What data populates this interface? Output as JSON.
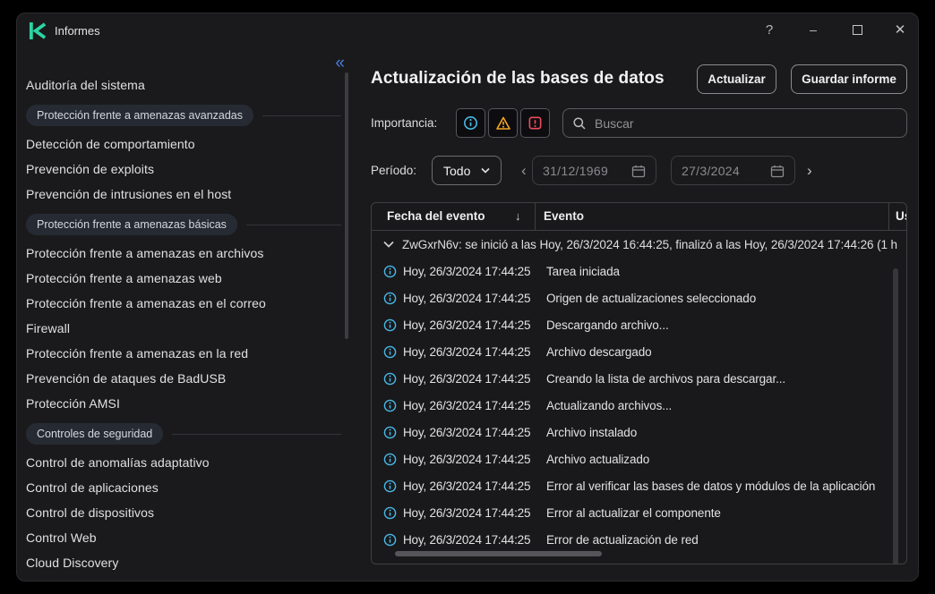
{
  "colors": {
    "brand_teal": "#2bd4a4",
    "info_blue": "#49b8e8",
    "warning_amber": "#f5a623",
    "critical_red": "#ee4b5e",
    "collapse_blue": "#4a7bd9"
  },
  "window": {
    "title": "Informes",
    "controls": {
      "help": "?",
      "minimize": "–",
      "close": "✕"
    }
  },
  "sidebar": {
    "collapse_icon": "«",
    "items": [
      {
        "type": "item",
        "label": "Auditoría del sistema"
      },
      {
        "type": "section",
        "label": "Protección frente a amenazas avanzadas"
      },
      {
        "type": "item",
        "label": "Detección de comportamiento"
      },
      {
        "type": "item",
        "label": "Prevención de exploits"
      },
      {
        "type": "item",
        "label": "Prevención de intrusiones en el host"
      },
      {
        "type": "section",
        "label": "Protección frente a amenazas básicas"
      },
      {
        "type": "item",
        "label": "Protección frente a amenazas en archivos"
      },
      {
        "type": "item",
        "label": "Protección frente a amenazas web"
      },
      {
        "type": "item",
        "label": "Protección frente a amenazas en el correo"
      },
      {
        "type": "item",
        "label": "Firewall"
      },
      {
        "type": "item",
        "label": "Protección frente a amenazas en la red"
      },
      {
        "type": "item",
        "label": "Prevención de ataques de BadUSB"
      },
      {
        "type": "item",
        "label": "Protección AMSI"
      },
      {
        "type": "section",
        "label": "Controles de seguridad"
      },
      {
        "type": "item",
        "label": "Control de anomalías adaptativo"
      },
      {
        "type": "item",
        "label": "Control de aplicaciones"
      },
      {
        "type": "item",
        "label": "Control de dispositivos"
      },
      {
        "type": "item",
        "label": "Control Web"
      },
      {
        "type": "item",
        "label": "Cloud Discovery"
      }
    ]
  },
  "main": {
    "title": "Actualización de las bases de datos",
    "buttons": {
      "update": "Actualizar",
      "save": "Guardar informe"
    },
    "filters": {
      "importance_label": "Importancia:",
      "search_placeholder": "Buscar",
      "period_label": "Período:",
      "period_value": "Todo",
      "nav_prev": "‹",
      "nav_next": "›",
      "date_from": "31/12/1969",
      "date_to": "27/3/2024"
    },
    "table": {
      "columns": [
        "Fecha del evento",
        "Evento",
        "Us"
      ],
      "sort_icon": "↓",
      "group_row": "ZwGxrN6v: se inició a las Hoy, 26/3/2024 16:44:25, finalizó a las Hoy, 26/3/2024 17:44:26 (1 h",
      "rows": [
        {
          "date": "Hoy, 26/3/2024 17:44:25",
          "event": "Tarea iniciada"
        },
        {
          "date": "Hoy, 26/3/2024 17:44:25",
          "event": "Origen de actualizaciones seleccionado"
        },
        {
          "date": "Hoy, 26/3/2024 17:44:25",
          "event": "Descargando archivo..."
        },
        {
          "date": "Hoy, 26/3/2024 17:44:25",
          "event": "Archivo descargado"
        },
        {
          "date": "Hoy, 26/3/2024 17:44:25",
          "event": "Creando la lista de archivos para descargar..."
        },
        {
          "date": "Hoy, 26/3/2024 17:44:25",
          "event": "Actualizando archivos..."
        },
        {
          "date": "Hoy, 26/3/2024 17:44:25",
          "event": "Archivo instalado"
        },
        {
          "date": "Hoy, 26/3/2024 17:44:25",
          "event": "Archivo actualizado"
        },
        {
          "date": "Hoy, 26/3/2024 17:44:25",
          "event": "Error al verificar las bases de datos y módulos de la aplicación"
        },
        {
          "date": "Hoy, 26/3/2024 17:44:25",
          "event": "Error al actualizar el componente"
        },
        {
          "date": "Hoy, 26/3/2024 17:44:25",
          "event": "Error de actualización de red"
        }
      ]
    }
  }
}
